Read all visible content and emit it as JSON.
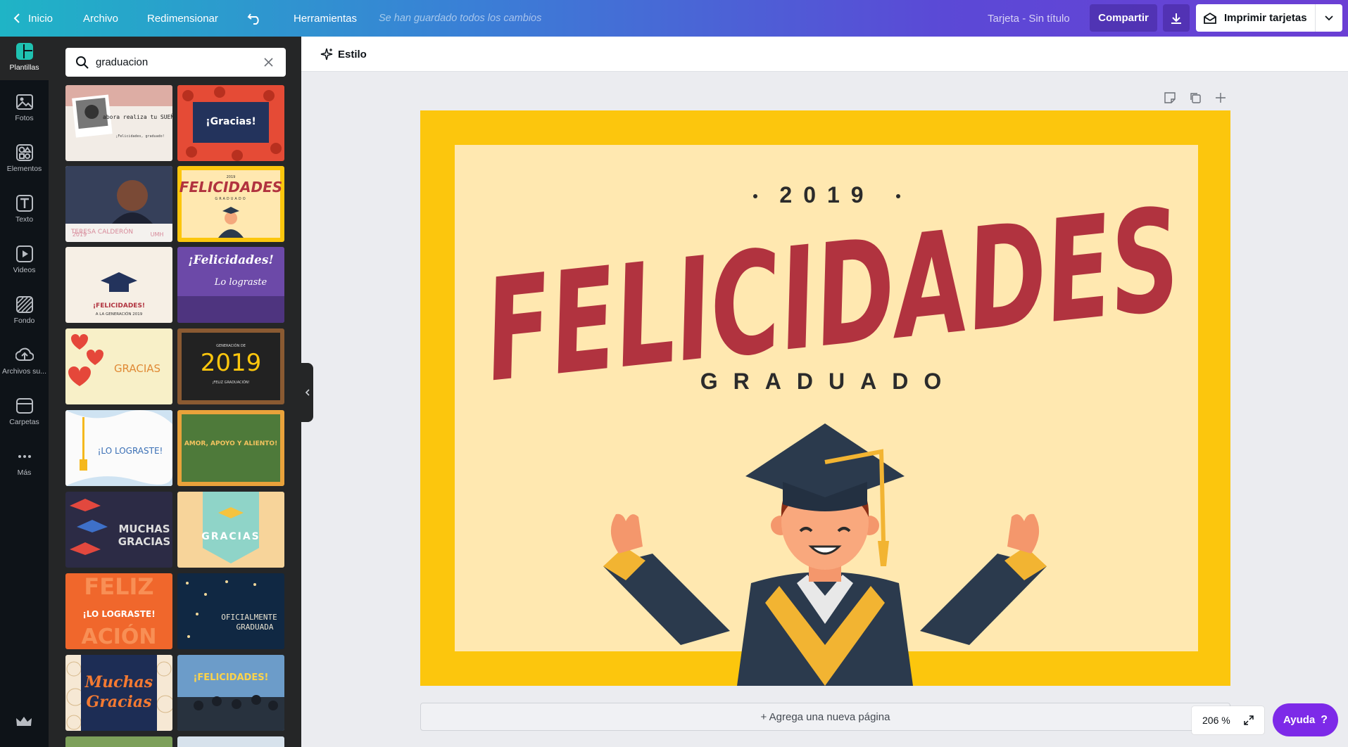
{
  "topbar": {
    "home": "Inicio",
    "file": "Archivo",
    "resize": "Redimensionar",
    "tools": "Herramientas",
    "saved_status": "Se han guardado todos los cambios",
    "doc_title": "Tarjeta - Sin título",
    "share": "Compartir",
    "print": "Imprimir tarjetas"
  },
  "sidebar": {
    "items": [
      {
        "label": "Plantillas",
        "icon": "templates-icon"
      },
      {
        "label": "Fotos",
        "icon": "photos-icon"
      },
      {
        "label": "Elementos",
        "icon": "elements-icon"
      },
      {
        "label": "Texto",
        "icon": "text-icon"
      },
      {
        "label": "Videos",
        "icon": "video-icon"
      },
      {
        "label": "Fondo",
        "icon": "background-icon"
      },
      {
        "label": "Archivos su...",
        "icon": "upload-icon"
      },
      {
        "label": "Carpetas",
        "icon": "folder-icon"
      },
      {
        "label": "Más",
        "icon": "more-icon"
      }
    ]
  },
  "search": {
    "value": "graduacion"
  },
  "templates": [
    {
      "t1": "abora realiza tu SUEÑO",
      "t2": "¡Felicidades, graduado!"
    },
    {
      "t1": "¡Gracias!"
    },
    {
      "t1": "TERESA CALDERÓN",
      "t2": "2019",
      "t3": "UMH"
    },
    {
      "t1": "FELICIDADES",
      "t2": "GRADUADO",
      "t3": "2019"
    },
    {
      "t1": "¡FELICIDADES!",
      "t2": "A LA GENERACIÓN 2019"
    },
    {
      "t1": "¡Felicidades!",
      "t2": "Lo lograste"
    },
    {
      "t1": "GRACIAS"
    },
    {
      "t1": "2019",
      "t2": "GENERACIÓN DE",
      "t3": "¡FELIZ GRADUACIÓN!"
    },
    {
      "t1": "¡LO LOGRASTE!"
    },
    {
      "t1": "AMOR, APOYO Y ALIENTO!"
    },
    {
      "t1": "MUCHAS",
      "t2": "GRACIAS"
    },
    {
      "t1": "GRACIAS"
    },
    {
      "t1": "FELIZ",
      "t2": "¡LO LOGRASTE!",
      "t3": "ACIÓN"
    },
    {
      "t1": "OFICIALMENTE",
      "t2": "GRADUADA"
    },
    {
      "t1": "Muchas",
      "t2": "Gracias"
    },
    {
      "t1": "¡FELICIDADES!"
    }
  ],
  "toolbar": {
    "style": "Estilo"
  },
  "design": {
    "year": "2019",
    "headline": "FELICIDADES",
    "subtitle": "GRADUADO"
  },
  "footer": {
    "add_page": "+ Agrega una nueva página",
    "zoom": "206 %",
    "help": "Ayuda",
    "help_icon": "?"
  },
  "colors": {
    "brand_purple": "#7d2ae8",
    "card_yellow": "#fcc60d",
    "card_cream": "#ffe8b0",
    "headline_red": "#b1333f",
    "navy": "#2b3a4d"
  }
}
